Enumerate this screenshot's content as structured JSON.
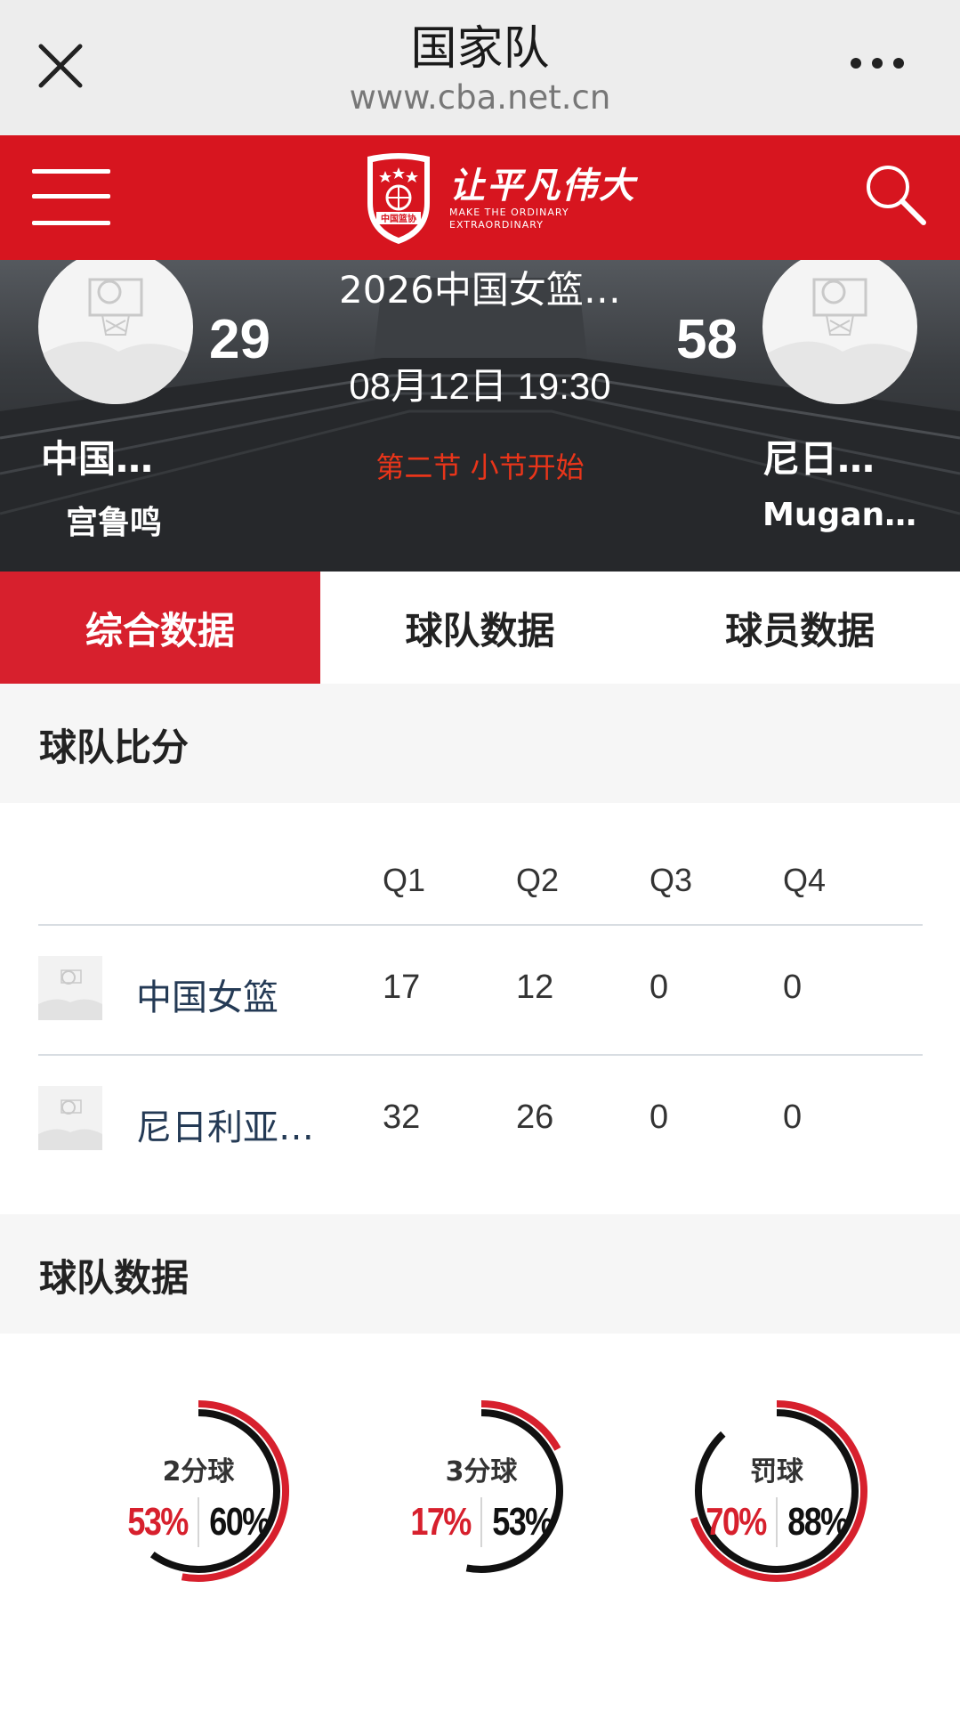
{
  "nav": {
    "title": "国家队",
    "url": "www.cba.net.cn"
  },
  "header": {
    "logo_text": "中国篮协",
    "slogan_cn": "让平凡伟大",
    "slogan_en_1": "MAKE THE ORDINARY",
    "slogan_en_2": "EXTRAORDINARY"
  },
  "match": {
    "title": "2026中国女篮…",
    "time": "08月12日 19:30",
    "status": "第二节 小节开始",
    "home": {
      "name": "中国…",
      "coach": "宫鲁鸣",
      "score": "29"
    },
    "away": {
      "name": "尼日…",
      "coach": "Mugan…",
      "score": "58"
    }
  },
  "tabs": [
    "综合数据",
    "球队数据",
    "球员数据"
  ],
  "score_section": {
    "title": "球队比分",
    "headers": [
      "Q1",
      "Q2",
      "Q3",
      "Q4"
    ],
    "rows": [
      {
        "team": "中国女篮",
        "q": [
          "17",
          "12",
          "0",
          "0"
        ]
      },
      {
        "team": "尼日利亚…",
        "q": [
          "32",
          "26",
          "0",
          "0"
        ]
      }
    ]
  },
  "stats_section": {
    "title": "球队数据",
    "rings": [
      {
        "label": "2分球",
        "home": "53%",
        "away": "60%",
        "home_value": 53,
        "away_value": 60
      },
      {
        "label": "3分球",
        "home": "17%",
        "away": "53%",
        "home_value": 17,
        "away_value": 53
      },
      {
        "label": "罚球",
        "home": "70%",
        "away": "88%",
        "home_value": 70,
        "away_value": 88
      }
    ]
  },
  "colors": {
    "accent": "#d7202d",
    "header": "#d7151f"
  }
}
